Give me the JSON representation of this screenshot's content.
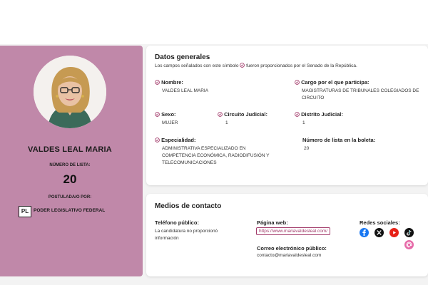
{
  "profile": {
    "name": "VALDES LEAL MARIA",
    "list_label": "NÚMERO DE LISTA:",
    "list_number": "20",
    "postulated_label": "POSTULADA/O POR:",
    "party_abbrev": "PL",
    "party_name": "PODER LEGISLATIVO FEDERAL"
  },
  "general": {
    "title": "Datos generales",
    "note_before": "Los campos señalados con este símbolo",
    "note_after": "fueron proporcionados por el Senado de la República.",
    "fields": {
      "nombre_label": "Nombre:",
      "nombre_value": "VALDES LEAL MARIA",
      "cargo_label": "Cargo por el que participa:",
      "cargo_value": "MAGISTRATURAS DE TRIBUNALES COLEGIADOS DE CIRCUITO",
      "sexo_label": "Sexo:",
      "sexo_value": "MUJER",
      "circuito_label": "Circuito Judicial:",
      "circuito_value": "1",
      "distrito_label": "Distrito Judicial:",
      "distrito_value": "1",
      "especialidad_label": "Especialidad:",
      "especialidad_value": "ADMINISTRATIVA ESPECIALIZADO EN COMPETENCIA ECONÓMICA, RADIODIFUSIÓN Y TELECOMUNICACIONES",
      "numero_label": "Número de lista en la boleta:",
      "numero_value": "20"
    }
  },
  "contact": {
    "title": "Medios de contacto",
    "phone_label": "Teléfono público:",
    "phone_value": "La candidatura no proporcionó información",
    "web_label": "Página web:",
    "web_value": "https://www.mariavaldesleal.com/",
    "email_label": "Correo electrónico público:",
    "email_value": "contacto@mariavaldesleal.com",
    "social_label": "Redes sociales:",
    "social_icons": [
      "facebook-icon",
      "x-icon",
      "youtube-icon",
      "tiktok-icon",
      "threads-icon"
    ]
  },
  "colors": {
    "profile_bg": "#c088a9",
    "accent": "#a23a6a",
    "facebook": "#1877f2",
    "youtube": "#e62117",
    "threads": "#e66aa8"
  }
}
